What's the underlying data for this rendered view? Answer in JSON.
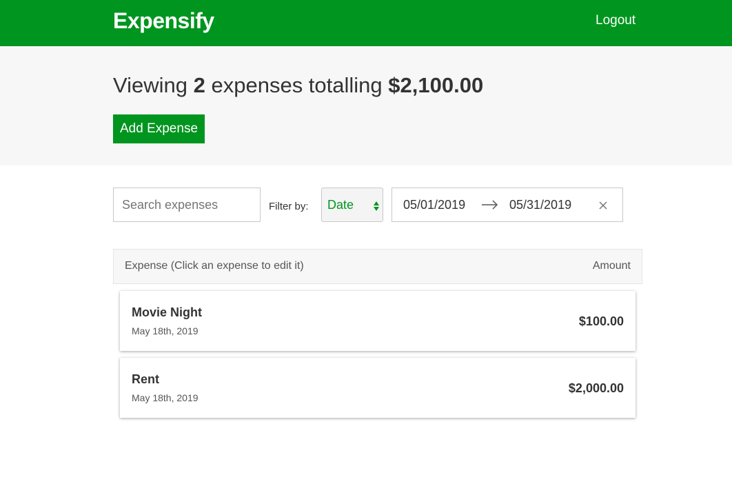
{
  "header": {
    "brand": "Expensify",
    "logout_label": "Logout"
  },
  "summary": {
    "prefix": "Viewing ",
    "count": "2",
    "middle": " expenses totalling ",
    "total": "$2,100.00",
    "add_label": "Add Expense"
  },
  "filters": {
    "search_placeholder": "Search expenses",
    "search_value": "",
    "filter_label": "Filter by:",
    "sort_selected": "Date",
    "start_date": "05/01/2019",
    "end_date": "05/31/2019"
  },
  "list": {
    "col_expense": "Expense (Click an expense to edit it)",
    "col_amount": "Amount",
    "items": [
      {
        "description": "Movie Night",
        "date": "May 18th, 2019",
        "amount": "$100.00"
      },
      {
        "description": "Rent",
        "date": "May 18th, 2019",
        "amount": "$2,000.00"
      }
    ]
  },
  "colors": {
    "brand_green": "#00951f",
    "summary_bg": "#f7f7f7",
    "text": "#333333"
  },
  "icons": {
    "select_arrows": "up-down-triangles-icon",
    "date_arrow": "right-arrow-icon",
    "clear": "close-icon"
  }
}
